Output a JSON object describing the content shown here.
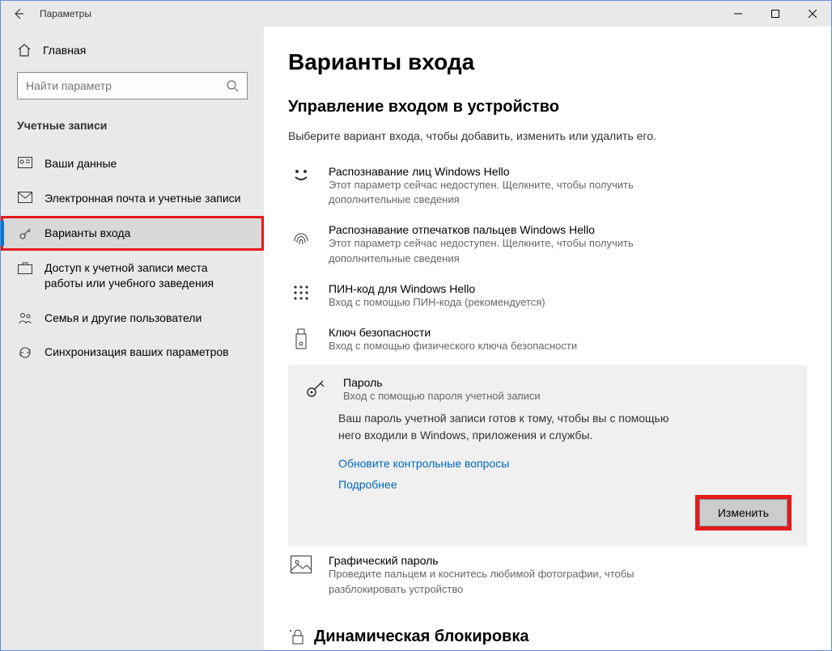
{
  "window": {
    "title": "Параметры"
  },
  "sidebar": {
    "home": "Главная",
    "search_placeholder": "Найти параметр",
    "section": "Учетные записи",
    "items": [
      {
        "label": "Ваши данные"
      },
      {
        "label": "Электронная почта и учетные записи"
      },
      {
        "label": "Варианты входа"
      },
      {
        "label": "Доступ к учетной записи места работы или учебного заведения"
      },
      {
        "label": "Семья и другие пользователи"
      },
      {
        "label": "Синхронизация ваших параметров"
      }
    ]
  },
  "page": {
    "title": "Варианты входа",
    "section_title": "Управление входом в устройство",
    "subtitle": "Выберите вариант входа, чтобы добавить, изменить или удалить его.",
    "options": {
      "face": {
        "title": "Распознавание лиц Windows Hello",
        "desc": "Этот параметр сейчас недоступен. Щелкните, чтобы получить дополнительные сведения"
      },
      "finger": {
        "title": "Распознавание отпечатков пальцев Windows Hello",
        "desc": "Этот параметр сейчас недоступен. Щелкните, чтобы получить дополнительные сведения"
      },
      "pin": {
        "title": "ПИН-код для Windows Hello",
        "desc": "Вход с помощью ПИН-кода (рекомендуется)"
      },
      "seckey": {
        "title": "Ключ безопасности",
        "desc": "Вход с помощью физического ключа безопасности"
      },
      "password": {
        "title": "Пароль",
        "desc": "Вход с помощью пароля учетной записи",
        "note": "Ваш пароль учетной записи готов к тому, чтобы вы с помощью него входили в Windows, приложения и службы.",
        "link1": "Обновите контрольные вопросы",
        "link2": "Подробнее",
        "button": "Изменить"
      },
      "picture": {
        "title": "Графический пароль",
        "desc": "Проведите пальцем и коснитесь любимой фотографии, чтобы разблокировать устройство"
      }
    },
    "dynamic_lock": "Динамическая блокировка"
  }
}
